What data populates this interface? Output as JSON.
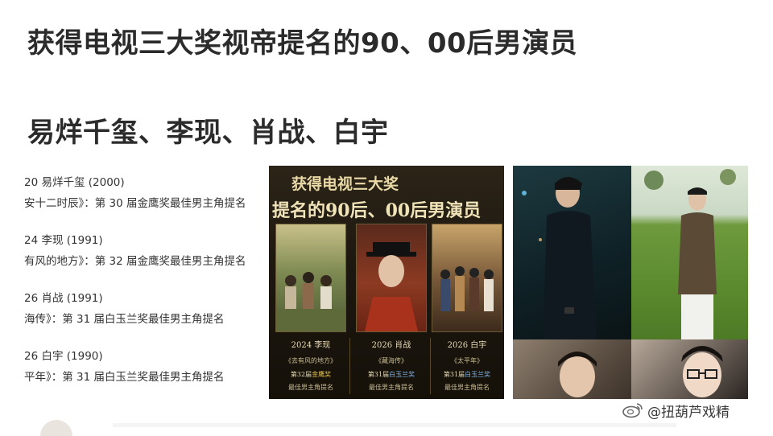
{
  "headline": {
    "line1": "获得电视三大奖视帝提名的90、00后男演员",
    "line2": "易烊千玺、李现、肖战、白宇"
  },
  "list": [
    {
      "line1": "20 易烊千玺 (2000)",
      "line2": "安十二时辰》：第 30 届金鹰奖最佳男主角提名"
    },
    {
      "line1": "24 李现 (1991)",
      "line2": "有风的地方》：第 32 届金鹰奖最佳男主角提名"
    },
    {
      "line1": "26 肖战 (1991)",
      "line2": "海传》：第 31 届白玉兰奖最佳男主角提名"
    },
    {
      "line1": "26 白宇 (1990)",
      "line2": "平年》：第 31 届白玉兰奖最佳男主角提名"
    }
  ],
  "poster": {
    "title1": "获得电视三大奖",
    "title2": "提名的90后、00后男演员",
    "columns": [
      {
        "year_name": "2024 李现",
        "work": "《去有风的地方》",
        "award_prefix": "第32届",
        "award_hl": "金鹰奖",
        "note": "最佳男主角提名"
      },
      {
        "year_name": "2026 肖战",
        "work": "《藏海传》",
        "award_prefix": "第31届",
        "award_hl": "白玉兰奖",
        "note": "最佳男主角提名"
      },
      {
        "year_name": "2026 白宇",
        "work": "《太平年》",
        "award_prefix": "第31届",
        "award_hl": "白玉兰奖",
        "note": "最佳男主角提名"
      }
    ]
  },
  "watermark": "@扭葫芦戏精",
  "colors": {
    "poster_gold": "#e9d9a6",
    "award_highlight": "#e6c34b",
    "text_dark": "#2b2b2b"
  }
}
